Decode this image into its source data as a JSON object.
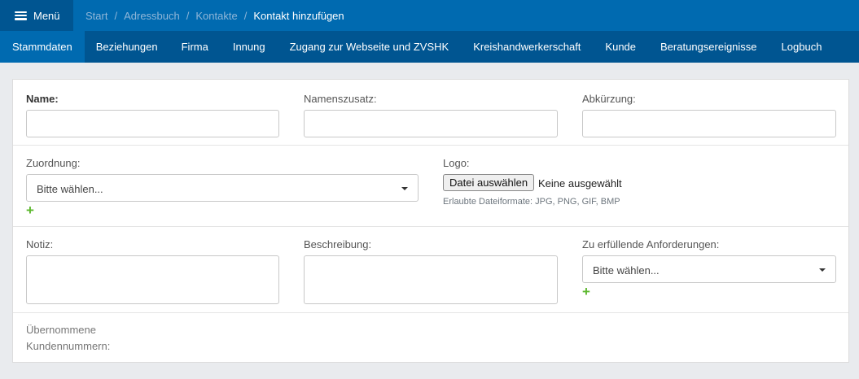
{
  "header": {
    "menu_label": "Menü",
    "breadcrumb": [
      "Start",
      "Adressbuch",
      "Kontakte"
    ],
    "breadcrumb_current": "Kontakt hinzufügen",
    "separator": "/"
  },
  "tabs": [
    "Stammdaten",
    "Beziehungen",
    "Firma",
    "Innung",
    "Zugang zur Webseite und ZVSHK",
    "Kreishandwerkerschaft",
    "Kunde",
    "Beratungsereignisse",
    "Logbuch"
  ],
  "form": {
    "name_label": "Name:",
    "namenszusatz_label": "Namenszusatz:",
    "abkuerzung_label": "Abkürzung:",
    "zuordnung_label": "Zuordnung:",
    "zuordnung_value": "Bitte wählen...",
    "logo_label": "Logo:",
    "file_button": "Datei auswählen",
    "file_status": "Keine ausgewählt",
    "file_hint": "Erlaubte Dateiformate: JPG, PNG, GIF, BMP",
    "notiz_label": "Notiz:",
    "beschreibung_label": "Beschreibung:",
    "anforderungen_label": "Zu erfüllende Anforderungen:",
    "anforderungen_value": "Bitte wählen...",
    "kundennummern_label_1": "Übernommene",
    "kundennummern_label_2": "Kundennummern:",
    "plus": "+"
  },
  "colors": {
    "header": "#006ab0",
    "tabs": "#005591",
    "add": "#5cb82e"
  }
}
